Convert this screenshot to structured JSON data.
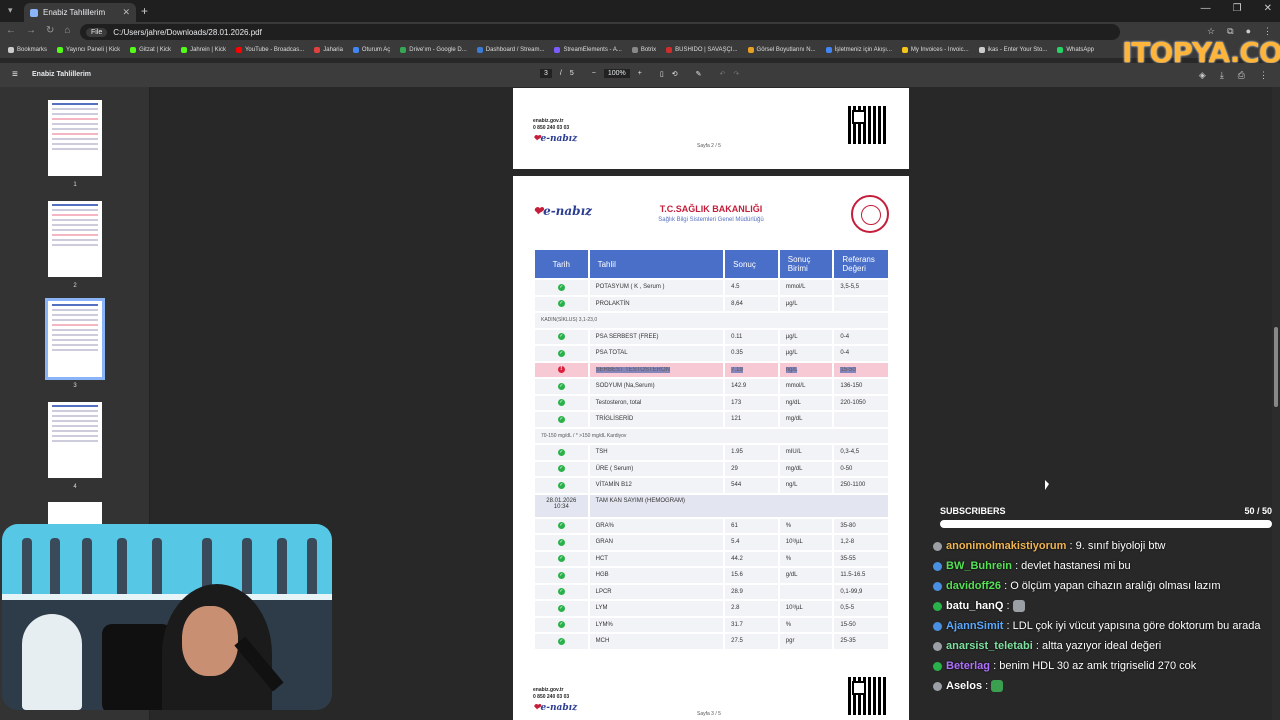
{
  "browser": {
    "tab_title": "Enabiz Tahlillerim",
    "address_chip": "File",
    "url": "C:/Users/jahre/Downloads/28.01.2026.pdf",
    "bookmarks": [
      {
        "label": "Bookmarks",
        "color": "#cccccc"
      },
      {
        "label": "Yayıncı Paneli | Kick",
        "color": "#53fc18"
      },
      {
        "label": "Gitzat | Kick",
        "color": "#53fc18"
      },
      {
        "label": "Jahrein | Kick",
        "color": "#53fc18"
      },
      {
        "label": "YouTube - Broadcas...",
        "color": "#ff0000"
      },
      {
        "label": "Jaharia",
        "color": "#e04040"
      },
      {
        "label": "Oturum Aç",
        "color": "#4285f4"
      },
      {
        "label": "Drive'ım - Google D...",
        "color": "#34a853"
      },
      {
        "label": "Dashboard / Stream...",
        "color": "#3a7bd5"
      },
      {
        "label": "StreamElements - A...",
        "color": "#7b5cff"
      },
      {
        "label": "Botrix",
        "color": "#888888"
      },
      {
        "label": "BUSHIDO | SAVAŞÇI...",
        "color": "#d12c2c"
      },
      {
        "label": "Görsel Boyutlarını N...",
        "color": "#e8a020"
      },
      {
        "label": "İşletmeniz için Akışı...",
        "color": "#4285f4"
      },
      {
        "label": "My Invoices - Invoic...",
        "color": "#f5c518"
      },
      {
        "label": "ikas - Enter Your Sto...",
        "color": "#cccccc"
      },
      {
        "label": "WhatsApp",
        "color": "#25d366"
      }
    ]
  },
  "watermark": "ITOPYA.COM",
  "pdf": {
    "title": "Enabiz Tahlillerim",
    "page_current": "3",
    "page_total": "5",
    "zoom": "100%",
    "thumbnails": [
      "1",
      "2",
      "3",
      "4"
    ]
  },
  "prev_page_footer": {
    "site": "enabiz.gov.tr",
    "phone": "0 850 240 03 03",
    "page_label": "Sayfa 2 / 5"
  },
  "report": {
    "brand": "e-nabız",
    "ministry": "T.C.SAĞLIK BAKANLIĞI",
    "directorate": "Sağlık Bilgi Sistemleri Genel Müdürlüğü",
    "headers": {
      "date": "Tarih",
      "test": "Tahlil",
      "result": "Sonuç",
      "unit": "Sonuç Birimi",
      "ref": "Referans Değeri"
    },
    "rows": [
      {
        "status": "ok",
        "test": "POTASYUM ( K , Serum )",
        "result": "4.5",
        "unit": "mmol/L",
        "ref": "3,5-5,5"
      },
      {
        "status": "ok",
        "test": "PROLAKTİN",
        "result": "8,64",
        "unit": "µg/L",
        "ref": ""
      },
      {
        "note": "KADIN(SİKLUS) 3,1-23,0"
      },
      {
        "status": "ok",
        "test": "PSA SERBEST (FREE)",
        "result": "0.11",
        "unit": "µg/L",
        "ref": "0-4"
      },
      {
        "status": "ok",
        "test": "PSA TOTAL",
        "result": "0.35",
        "unit": "µg/L",
        "ref": "0-4"
      },
      {
        "status": "alert",
        "test": "SERBEST TESTOSTERON",
        "result": "7.19",
        "unit": "ng/L",
        "ref": "15-50"
      },
      {
        "status": "ok",
        "test": "SODYUM (Na,Serum)",
        "result": "142.9",
        "unit": "mmol/L",
        "ref": "136-150"
      },
      {
        "status": "ok",
        "test": "Testosteron, total",
        "result": "173",
        "unit": "ng/dL",
        "ref": "220-1050"
      },
      {
        "status": "ok",
        "test": "TRİGLİSERİD",
        "result": "121",
        "unit": "mg/dL",
        "ref": ""
      },
      {
        "note": "70-150 mg/dL / * >150 mg/dL Kardiyov"
      },
      {
        "status": "ok",
        "test": "TSH",
        "result": "1.95",
        "unit": "mIU/L",
        "ref": "0,3-4,5"
      },
      {
        "status": "ok",
        "test": "ÜRE ( Serum)",
        "result": "29",
        "unit": "mg/dL",
        "ref": "0-50"
      },
      {
        "status": "ok",
        "test": "VİTAMİN B12",
        "result": "544",
        "unit": "ng/L",
        "ref": "250-1100"
      },
      {
        "group_date": "28.01.2026",
        "group_time": "10:34",
        "group": "TAM KAN SAYIMI (HEMOGRAM)"
      },
      {
        "status": "ok",
        "test": "GRA%",
        "result": "61",
        "unit": "%",
        "ref": "35-80"
      },
      {
        "status": "ok",
        "test": "GRAN",
        "result": "5.4",
        "unit": "10³/µL",
        "ref": "1,2-8"
      },
      {
        "status": "ok",
        "test": "HCT",
        "result": "44.2",
        "unit": "%",
        "ref": "35-55"
      },
      {
        "status": "ok",
        "test": "HGB",
        "result": "15.6",
        "unit": "g/dL",
        "ref": "11.5-16.5"
      },
      {
        "status": "ok",
        "test": "LPCR",
        "result": "28.9",
        "unit": "",
        "ref": "0,1-99,9"
      },
      {
        "status": "ok",
        "test": "LYM",
        "result": "2.8",
        "unit": "10³/µL",
        "ref": "0,5-5"
      },
      {
        "status": "ok",
        "test": "LYM%",
        "result": "31.7",
        "unit": "%",
        "ref": "15-50"
      },
      {
        "status": "ok",
        "test": "MCH",
        "result": "27.5",
        "unit": "pgr",
        "ref": "25-35"
      }
    ],
    "footer": {
      "site": "enabiz.gov.tr",
      "phone": "0 850 240 03 03",
      "page_label": "Sayfa 3 / 5"
    }
  },
  "subscribers": {
    "label": "SUBSCRIBERS",
    "count": "50",
    "goal": "/ 50",
    "progress": 1.0
  },
  "chat": [
    {
      "user": "anonimolmakistiyorum",
      "color": "#f0b450",
      "text": ": 9. sınıf biyoloji btw",
      "badge": "#9aa0a6"
    },
    {
      "user": "BW_Buhrein",
      "color": "#56e056",
      "text": ": devlet hastanesi mi bu",
      "badge": "#4a90e2"
    },
    {
      "user": "davidoff26",
      "color": "#56e056",
      "text": ": O ölçüm yapan cihazın aralığı olması lazım",
      "badge": "#4a90e2"
    },
    {
      "user": "batu_hanQ",
      "color": "#ffffff",
      "text": ":",
      "badge": "#2ab24a",
      "emote": "#9aa0a6"
    },
    {
      "user": "AjannSimit",
      "color": "#5aa9ff",
      "text": ": LDL çok iyi vücut yapısına göre doktorum bu arada",
      "badge": "#4a90e2"
    },
    {
      "user": "anarsist_teletabi",
      "color": "#7fe0a0",
      "text": ": altta yazıyor ideal değeri",
      "badge": "#9aa0a6"
    },
    {
      "user": "Beterlag",
      "color": "#b070ff",
      "text": ": benim HDL 30 az amk trigriselid 270 cok",
      "badge": "#2ab24a"
    },
    {
      "user": "Aselos",
      "color": "#ffffff",
      "text": ":",
      "badge": "#9aa0a6",
      "emote": "#3aa050"
    }
  ]
}
